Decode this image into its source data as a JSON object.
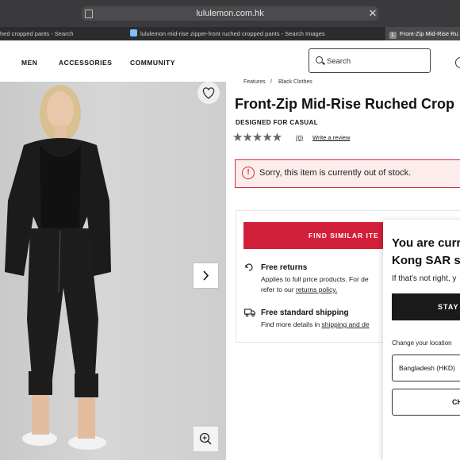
{
  "browser": {
    "url": "lululemon.com.hk",
    "tabs": [
      {
        "label": "hed cropped pants - Search"
      },
      {
        "label": "lululemon mid-rise zipper-front ruched cropped pants - Search Images"
      },
      {
        "label": "Front-Zip Mid-Rise Ru",
        "favicon": "L"
      }
    ]
  },
  "nav": {
    "items": [
      "MEN",
      "ACCESSORIES",
      "COMMUNITY"
    ],
    "search_placeholder": "Search"
  },
  "breadcrumb": [
    "Features",
    "/",
    "Black Clothes"
  ],
  "product": {
    "title": "Front-Zip Mid-Rise Ruched Crop",
    "designed_for": "DESIGNED FOR CASUAL",
    "rating_stars": "★★★★★",
    "review_count": "(0)",
    "write_review": "Write a review",
    "stock_alert": "Sorry, this item is currently out of stock.",
    "find_similar": "FIND SIMILAR ITE",
    "free_returns_title": "Free returns",
    "free_returns_text_1": "Applies to full price products. For de",
    "free_returns_text_2_prefix": "refer to our ",
    "free_returns_link": "returns policy.",
    "shipping_title": "Free standard shipping",
    "shipping_text_prefix": "Find more details in ",
    "shipping_link": "shipping and de"
  },
  "location_modal": {
    "title_line1": "You are curr",
    "title_line2": "Kong SAR si",
    "subtitle": "If that's not right, y",
    "stay_button": "STAY",
    "change_label": "Change your location",
    "selected_country": "Bangladesh (HKD)",
    "change_button": "CH"
  },
  "colors": {
    "brand_red": "#d3203a",
    "alert_bg": "#fdecec",
    "dark_button": "#1a1a1a"
  }
}
